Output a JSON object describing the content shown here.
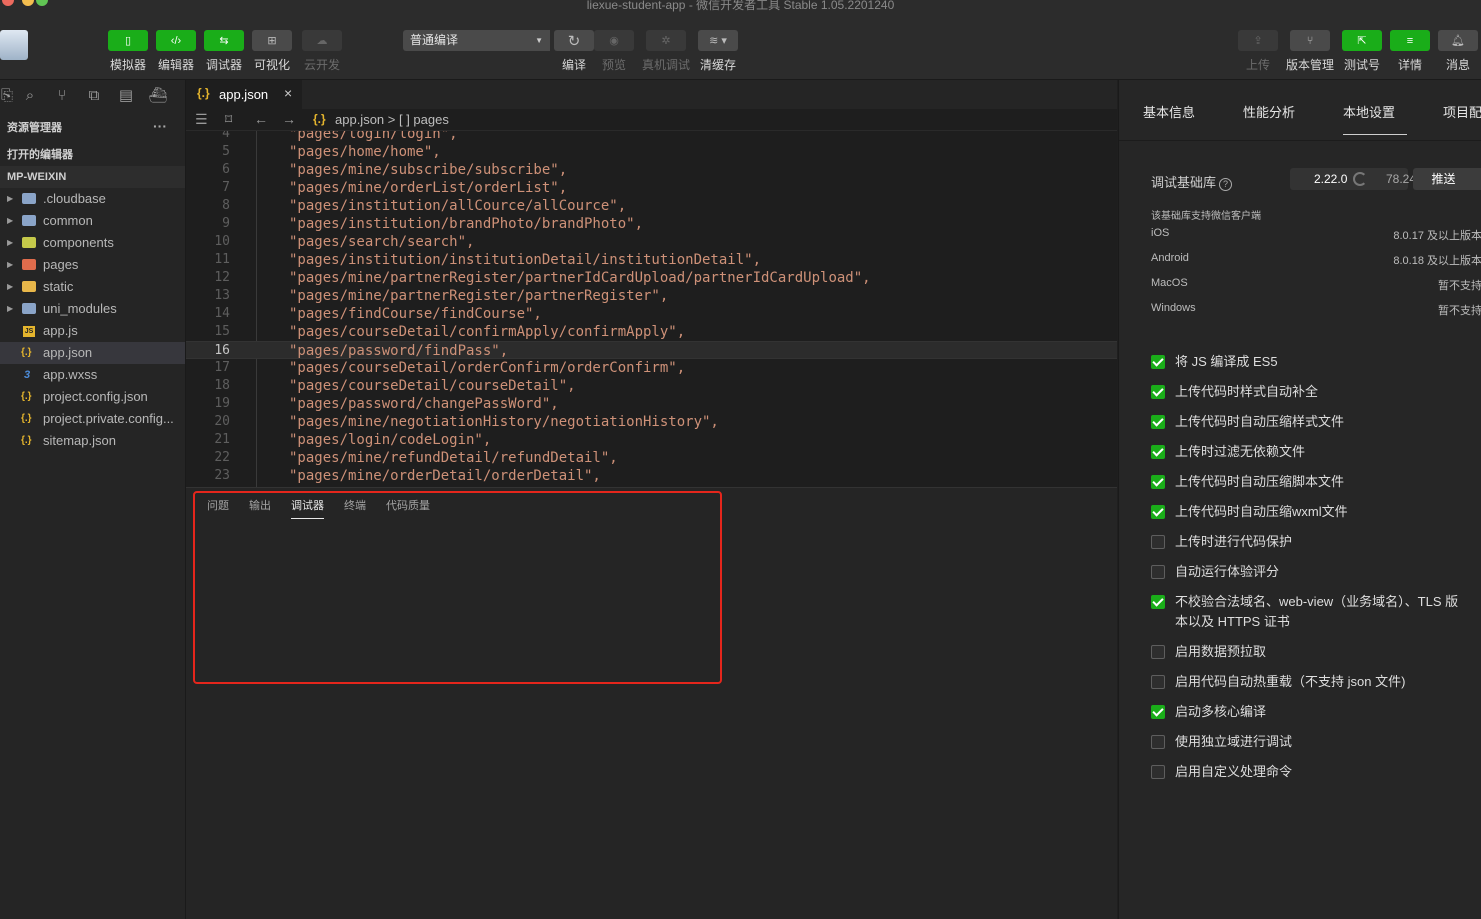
{
  "window": {
    "title": "liexue-student-app - 微信开发者工具 Stable 1.05.2201240"
  },
  "toolbar": {
    "left_buttons": [
      {
        "label": "模拟器",
        "icon": "phone-icon"
      },
      {
        "label": "编辑器",
        "icon": "code-icon"
      },
      {
        "label": "调试器",
        "icon": "debug-icon"
      },
      {
        "label": "可视化",
        "icon": "layout-icon"
      },
      {
        "label": "云开发",
        "icon": "cloud-icon"
      }
    ],
    "compile_mode": "普通编译",
    "mid_buttons": [
      {
        "label": "编译",
        "icon": "refresh-icon"
      },
      {
        "label": "预览",
        "icon": "eye-icon"
      },
      {
        "label": "真机调试",
        "icon": "bug-icon"
      },
      {
        "label": "清缓存",
        "icon": "layers-icon"
      }
    ],
    "right_buttons": [
      {
        "label": "上传",
        "icon": "upload-icon"
      },
      {
        "label": "版本管理",
        "icon": "branch-icon"
      },
      {
        "label": "测试号",
        "icon": "external-link-icon"
      },
      {
        "label": "详情",
        "icon": "menu-icon"
      },
      {
        "label": "消息",
        "icon": "bell-icon"
      }
    ]
  },
  "explorer": {
    "title": "资源管理器",
    "more": "···",
    "open_editors": "打开的编辑器",
    "project": "MP-WEIXIN",
    "items": [
      {
        "name": ".cloudbase",
        "type": "folder",
        "color": "#8aa4c8"
      },
      {
        "name": "common",
        "type": "folder",
        "color": "#8aa4c8"
      },
      {
        "name": "components",
        "type": "folder",
        "color": "#c5c94a"
      },
      {
        "name": "pages",
        "type": "folder",
        "color": "#e06c4c"
      },
      {
        "name": "static",
        "type": "folder",
        "color": "#e8b74a"
      },
      {
        "name": "uni_modules",
        "type": "folder",
        "color": "#8aa4c8"
      },
      {
        "name": "app.js",
        "type": "js"
      },
      {
        "name": "app.json",
        "type": "json",
        "active": true
      },
      {
        "name": "app.wxss",
        "type": "css"
      },
      {
        "name": "project.config.json",
        "type": "json"
      },
      {
        "name": "project.private.config...",
        "type": "json"
      },
      {
        "name": "sitemap.json",
        "type": "json"
      }
    ]
  },
  "editor": {
    "tab": {
      "name": "app.json",
      "icon": "{.}",
      "close": "×"
    },
    "breadcrumb": "app.json > [ ] pages",
    "breadcrumb_icon": "{.}",
    "current_line": 16,
    "lines": [
      {
        "n": "4",
        "text": "\"pages/login/login\","
      },
      {
        "n": "5",
        "text": "\"pages/home/home\","
      },
      {
        "n": "6",
        "text": "\"pages/mine/subscribe/subscribe\","
      },
      {
        "n": "7",
        "text": "\"pages/mine/orderList/orderList\","
      },
      {
        "n": "8",
        "text": "\"pages/institution/allCource/allCource\","
      },
      {
        "n": "9",
        "text": "\"pages/institution/brandPhoto/brandPhoto\","
      },
      {
        "n": "10",
        "text": "\"pages/search/search\","
      },
      {
        "n": "11",
        "text": "\"pages/institution/institutionDetail/institutionDetail\","
      },
      {
        "n": "12",
        "text": "\"pages/mine/partnerRegister/partnerIdCardUpload/partnerIdCardUpload\","
      },
      {
        "n": "13",
        "text": "\"pages/mine/partnerRegister/partnerRegister\","
      },
      {
        "n": "14",
        "text": "\"pages/findCourse/findCourse\","
      },
      {
        "n": "15",
        "text": "\"pages/courseDetail/confirmApply/confirmApply\","
      },
      {
        "n": "16",
        "text": "\"pages/password/findPass\","
      },
      {
        "n": "17",
        "text": "\"pages/courseDetail/orderConfirm/orderConfirm\","
      },
      {
        "n": "18",
        "text": "\"pages/courseDetail/courseDetail\","
      },
      {
        "n": "19",
        "text": "\"pages/password/changePassWord\","
      },
      {
        "n": "20",
        "text": "\"pages/mine/negotiationHistory/negotiationHistory\","
      },
      {
        "n": "21",
        "text": "\"pages/login/codeLogin\","
      },
      {
        "n": "22",
        "text": "\"pages/mine/refundDetail/refundDetail\","
      },
      {
        "n": "23",
        "text": "\"pages/mine/orderDetail/orderDetail\","
      }
    ]
  },
  "panel": {
    "tabs": [
      "问题",
      "输出",
      "调试器",
      "终端",
      "代码质量"
    ],
    "active_tab": "调试器"
  },
  "settings": {
    "tabs": [
      "基本信息",
      "性能分析",
      "本地设置",
      "项目配"
    ],
    "active_tab": "本地设置",
    "base_lib_label": "调试基础库",
    "help": "?",
    "base_lib_version": "2.22.0",
    "base_lib_usage": "78.24",
    "push_label": "推送",
    "support_title": "该基础库支持微信客户端",
    "support": [
      {
        "os": "iOS",
        "ver": "8.0.17 及以上版本"
      },
      {
        "os": "Android",
        "ver": "8.0.18 及以上版本"
      },
      {
        "os": "MacOS",
        "ver": "暂不支持"
      },
      {
        "os": "Windows",
        "ver": "暂不支持"
      }
    ],
    "options": [
      {
        "label": "将 JS 编译成 ES5",
        "checked": true
      },
      {
        "label": "上传代码时样式自动补全",
        "checked": true
      },
      {
        "label": "上传代码时自动压缩样式文件",
        "checked": true
      },
      {
        "label": "上传时过滤无依赖文件",
        "checked": true
      },
      {
        "label": "上传代码时自动压缩脚本文件",
        "checked": true
      },
      {
        "label": "上传代码时自动压缩wxml文件",
        "checked": true
      },
      {
        "label": "上传时进行代码保护",
        "checked": false
      },
      {
        "label": "自动运行体验评分",
        "checked": false
      },
      {
        "label": "不校验合法域名、web-view（业务域名）、TLS 版本以及 HTTPS 证书",
        "checked": true
      },
      {
        "label": "启用数据预拉取",
        "checked": false
      },
      {
        "label": "启用代码自动热重载（不支持 json 文件)",
        "checked": false
      },
      {
        "label": "启动多核心编译",
        "checked": true
      },
      {
        "label": "使用独立域进行调试",
        "checked": false
      },
      {
        "label": "启用自定义处理命令",
        "checked": false
      }
    ]
  }
}
